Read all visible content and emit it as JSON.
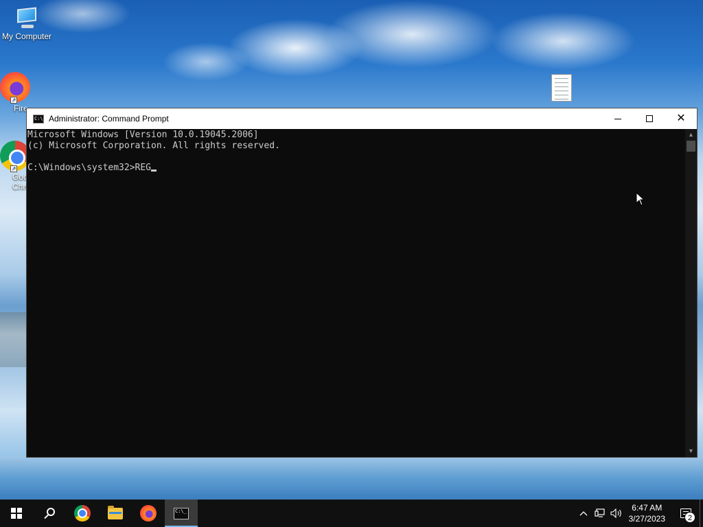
{
  "desktop": {
    "icons": [
      {
        "label": "My Computer",
        "icon": "computer-icon"
      },
      {
        "label": "Fire",
        "icon": "firefox-icon"
      },
      {
        "label": "Goo\nChro",
        "icon": "chrome-icon"
      },
      {
        "label": "",
        "icon": "text-document-icon"
      }
    ]
  },
  "window": {
    "title": "Administrator: Command Prompt",
    "app_icon_text": "C:\\_",
    "buttons": {
      "minimize": "minimize-icon",
      "maximize": "maximize-icon",
      "close": "✕"
    },
    "lines": [
      "Microsoft Windows [Version 10.0.19045.2006]",
      "(c) Microsoft Corporation. All rights reserved.",
      "",
      "C:\\Windows\\system32>REG"
    ]
  },
  "taskbar": {
    "apps": [
      {
        "name": "start",
        "icon": "windows-logo-icon"
      },
      {
        "name": "search",
        "icon": "search-icon"
      },
      {
        "name": "chrome",
        "icon": "chrome-icon"
      },
      {
        "name": "file-explorer",
        "icon": "folder-icon"
      },
      {
        "name": "firefox",
        "icon": "firefox-icon"
      },
      {
        "name": "command-prompt",
        "icon": "cmd-icon",
        "active": true
      }
    ],
    "tray": {
      "chevron": "^",
      "time": "6:47 AM",
      "date": "3/27/2023",
      "notification_count": "2"
    }
  },
  "colors": {
    "console_bg": "#0c0c0c",
    "console_text": "#cccccc",
    "taskbar_bg": "#101010",
    "active_indicator": "#76b9ed"
  }
}
